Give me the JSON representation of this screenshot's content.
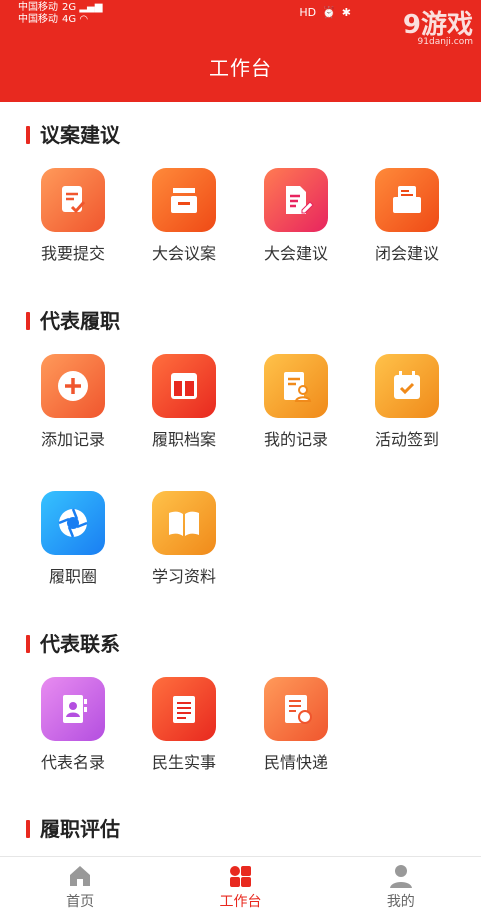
{
  "status_bar": {
    "carrier1": "中国移动",
    "carrier2": "中国移动",
    "net1": "2G",
    "net2": "4G"
  },
  "watermark": {
    "text": "9游戏",
    "url": "91danji.com"
  },
  "header": {
    "title": "工作台"
  },
  "sections": [
    {
      "title": "议案建议",
      "items": [
        {
          "label": "我要提交",
          "icon": "submit-doc-icon"
        },
        {
          "label": "大会议案",
          "icon": "inbox-icon"
        },
        {
          "label": "大会建议",
          "icon": "edit-doc-icon"
        },
        {
          "label": "闭会建议",
          "icon": "mail-card-icon"
        }
      ]
    },
    {
      "title": "代表履职",
      "items": [
        {
          "label": "添加记录",
          "icon": "plus-circle-icon"
        },
        {
          "label": "履职档案",
          "icon": "layout-icon"
        },
        {
          "label": "我的记录",
          "icon": "person-doc-icon"
        },
        {
          "label": "活动签到",
          "icon": "calendar-check-icon"
        },
        {
          "label": "履职圈",
          "icon": "aperture-icon"
        },
        {
          "label": "学习资料",
          "icon": "book-icon"
        }
      ]
    },
    {
      "title": "代表联系",
      "items": [
        {
          "label": "代表名录",
          "icon": "contacts-book-icon"
        },
        {
          "label": "民生实事",
          "icon": "list-doc-icon"
        },
        {
          "label": "民情快递",
          "icon": "notebook-min-icon"
        }
      ]
    },
    {
      "title": "履职评估"
    }
  ],
  "tabbar": [
    {
      "label": "首页",
      "icon": "home-icon"
    },
    {
      "label": "工作台",
      "icon": "grid-icon",
      "active": true
    },
    {
      "label": "我的",
      "icon": "user-icon"
    }
  ],
  "colors": {
    "primary": "#e8291f"
  }
}
